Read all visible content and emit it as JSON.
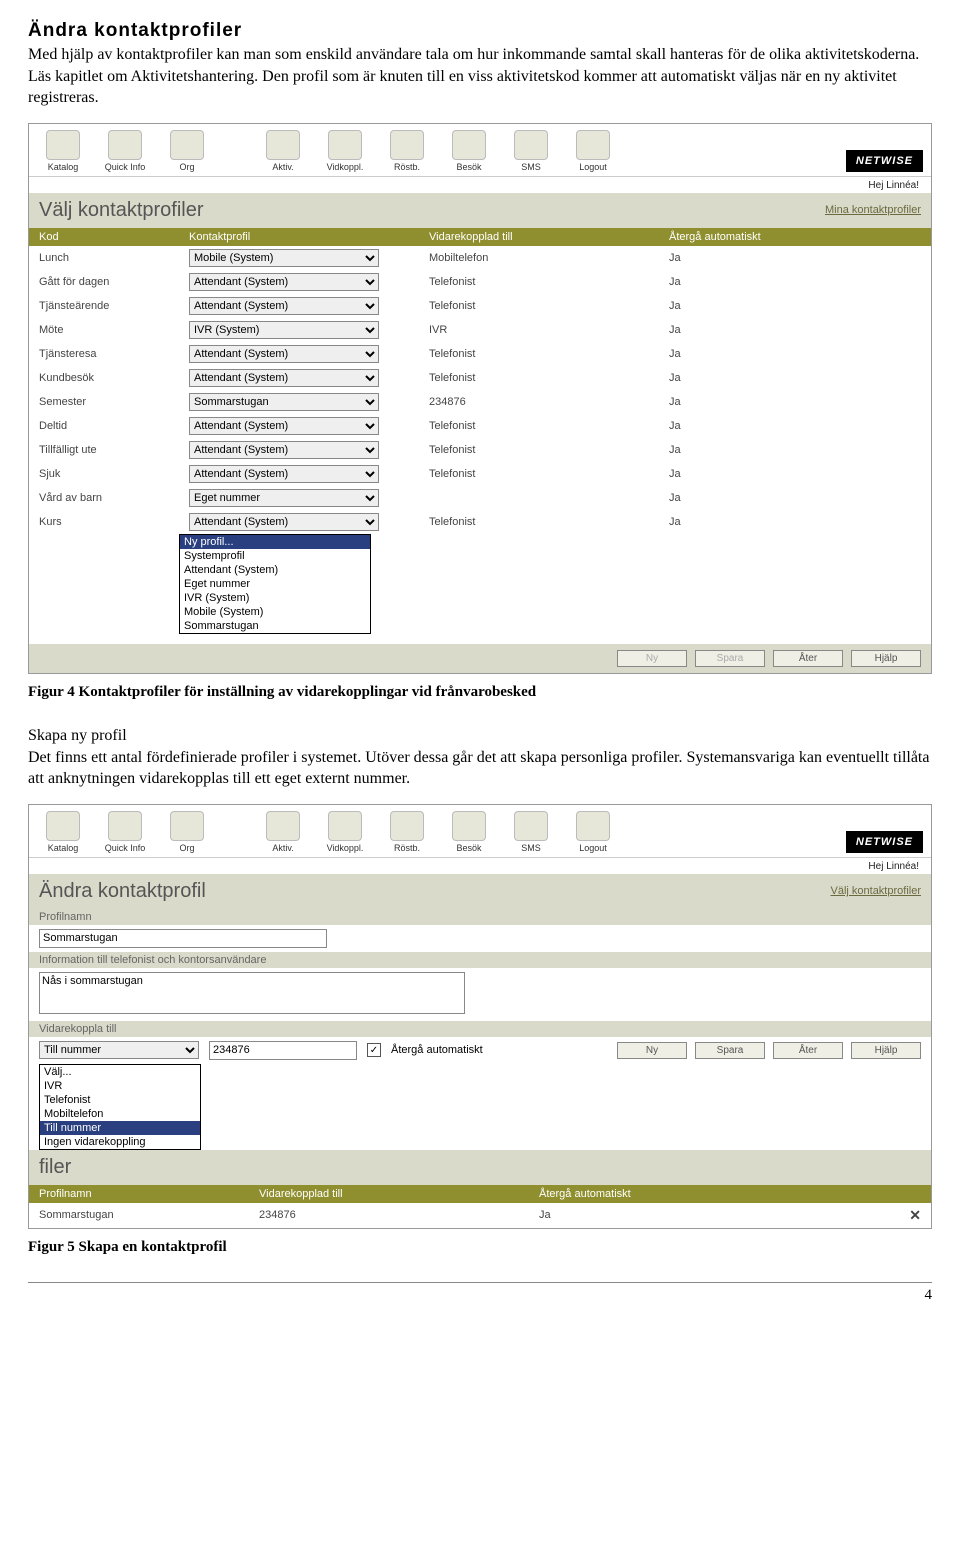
{
  "heading": "Ändra kontaktprofiler",
  "intro": "Med hjälp av kontaktprofiler kan man som enskild användare tala om hur inkommande samtal skall hanteras för de olika aktivitetskoderna. Läs kapitlet om Aktivitetshantering. Den profil som är knuten till en viss aktivitetskod kommer att automatiskt väljas när en ny aktivitet registreras.",
  "toolbar": {
    "items": [
      "Katalog",
      "Quick Info",
      "Org",
      "Aktiv.",
      "Vidkoppl.",
      "Röstb.",
      "Besök",
      "SMS",
      "Logout"
    ],
    "brand": "NETWISE",
    "greeting": "Hej Linnéa!"
  },
  "screenshot1": {
    "title": "Välj kontaktprofiler",
    "link": "Mina kontaktprofiler",
    "columns": [
      "Kod",
      "Kontaktprofil",
      "Vidarekopplad till",
      "Återgå automatiskt"
    ],
    "rows": [
      {
        "kod": "Lunch",
        "profil": "Mobile (System)",
        "vidare": "Mobiltelefon",
        "ater": "Ja"
      },
      {
        "kod": "Gått för dagen",
        "profil": "Attendant (System)",
        "vidare": "Telefonist",
        "ater": "Ja"
      },
      {
        "kod": "Tjänsteärende",
        "profil": "Attendant (System)",
        "vidare": "Telefonist",
        "ater": "Ja"
      },
      {
        "kod": "Möte",
        "profil": "IVR (System)",
        "vidare": "IVR",
        "ater": "Ja"
      },
      {
        "kod": "Tjänsteresa",
        "profil": "Attendant (System)",
        "vidare": "Telefonist",
        "ater": "Ja"
      },
      {
        "kod": "Kundbesök",
        "profil": "Attendant (System)",
        "vidare": "Telefonist",
        "ater": "Ja"
      },
      {
        "kod": "Semester",
        "profil": "Sommarstugan",
        "vidare": "234876",
        "ater": "Ja"
      },
      {
        "kod": "Deltid",
        "profil": "Attendant (System)",
        "vidare": "Telefonist",
        "ater": "Ja"
      },
      {
        "kod": "Tillfälligt ute",
        "profil": "Attendant (System)",
        "vidare": "Telefonist",
        "ater": "Ja"
      },
      {
        "kod": "Sjuk",
        "profil": "Attendant (System)",
        "vidare": "Telefonist",
        "ater": "Ja"
      },
      {
        "kod": "Vård av barn",
        "profil": "Eget nummer",
        "vidare": "",
        "ater": "Ja"
      },
      {
        "kod": "Kurs",
        "profil": "Attendant (System)",
        "vidare": "Telefonist",
        "ater": "Ja"
      }
    ],
    "dropdown_options": [
      "Ny profil...",
      "Systemprofil",
      "Attendant (System)",
      "Eget nummer",
      "IVR (System)",
      "Mobile (System)",
      "Sommarstugan"
    ],
    "buttons": {
      "ny": "Ny",
      "spara": "Spara",
      "ater": "Åter",
      "hjalp": "Hjälp"
    }
  },
  "figure4": "Figur 4  Kontaktprofiler för inställning av vidarekopplingar vid frånvarobesked",
  "subheading": "Skapa ny profil",
  "paragraph2": "Det finns ett antal fördefinierade profiler i systemet. Utöver dessa går det att skapa personliga profiler. Systemansvariga kan eventuellt tillåta att anknytningen vidarekopplas till ett eget externt nummer.",
  "screenshot2": {
    "title": "Ändra kontaktprofil",
    "link": "Välj kontaktprofiler",
    "label_profilnamn": "Profilnamn",
    "value_profilnamn": "Sommarstugan",
    "label_info": "Information till telefonist och kontorsanvändare",
    "value_info": "Nås i sommarstugan",
    "label_vidarekoppla": "Vidarekoppla till",
    "select_value": "Till nummer",
    "number_value": "234876",
    "checkbox_label": "Återgå automatiskt",
    "dropdown_options": [
      "Välj...",
      "IVR",
      "Telefonist",
      "Mobiltelefon",
      "Till nummer",
      "Ingen vidarekoppling"
    ],
    "buttons": {
      "ny": "Ny",
      "spara": "Spara",
      "ater": "Åter",
      "hjalp": "Hjälp"
    },
    "sub_title": "filer",
    "mini_columns": [
      "Profilnamn",
      "Vidarekopplad till",
      "Återgå automatiskt"
    ],
    "mini_row": {
      "namn": "Sommarstugan",
      "vidare": "234876",
      "ater": "Ja"
    }
  },
  "figure5": "Figur 5  Skapa en kontaktprofil",
  "page_number": "4"
}
